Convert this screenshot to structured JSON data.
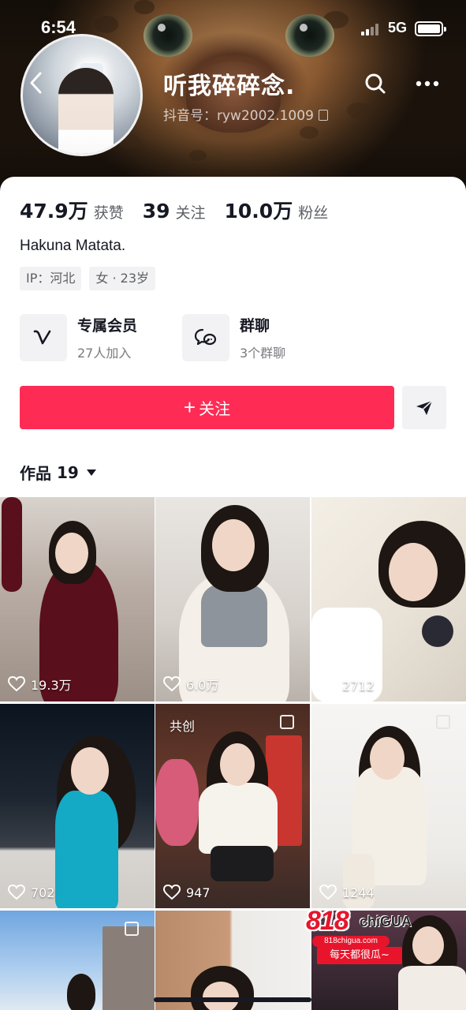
{
  "status_bar": {
    "time": "6:54",
    "network": "5G"
  },
  "profile": {
    "name": "听我碎碎念.",
    "douyin_id": "抖音号：ryw2002.1009",
    "bio": "Hakuna Matata.",
    "tags": [
      "IP：河北",
      "女 · 23岁"
    ]
  },
  "stats": [
    {
      "value": "47.9万",
      "label": "获赞"
    },
    {
      "value": "39",
      "label": "关注"
    },
    {
      "value": "10.0万",
      "label": "粉丝"
    }
  ],
  "features": {
    "membership": {
      "title": "专属会员",
      "subtitle": "27人加入",
      "icon": "v-badge-icon"
    },
    "group_chat": {
      "title": "群聊",
      "subtitle": "3个群聊",
      "icon": "chat-bubble-icon"
    }
  },
  "actions": {
    "follow_label": "关注",
    "follow_icon": "plus-icon",
    "share_icon": "paper-plane-icon"
  },
  "works": {
    "label": "作品",
    "count": "19"
  },
  "videos": [
    {
      "likes": "19.3万"
    },
    {
      "likes": "6.0万"
    },
    {
      "likes": "2712"
    },
    {
      "likes": "702"
    },
    {
      "likes": "947",
      "badge": "共创"
    },
    {
      "likes": "1244"
    },
    {
      "likes": ""
    },
    {
      "likes": ""
    },
    {
      "likes": ""
    }
  ],
  "ad": {
    "logo": "818",
    "brand": "chiGUA",
    "url": "818chigua.com",
    "slogan": "每天都很瓜~"
  },
  "colors": {
    "accent": "#fe2c55",
    "text": "#161823",
    "secondary": "#5d5f66",
    "chip_bg": "#f2f2f4"
  }
}
